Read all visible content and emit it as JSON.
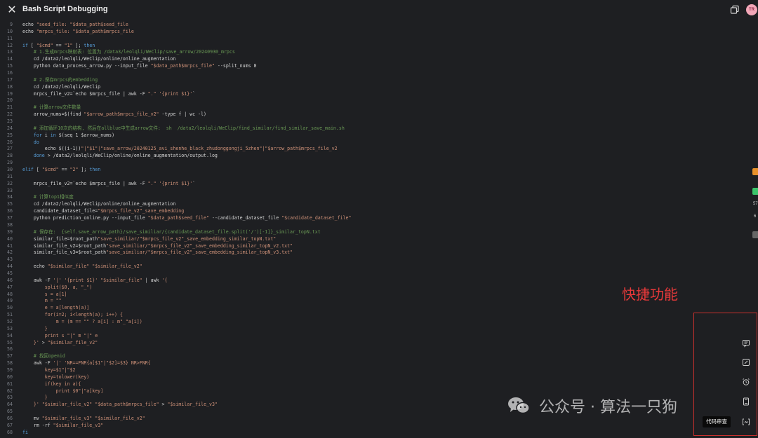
{
  "window": {
    "title": "Bash Script Debugging",
    "avatar_initials": "TR"
  },
  "code_lines": [
    {
      "n": "9",
      "segs": [
        [
          "plain",
          "echo "
        ],
        [
          "str",
          "\"seed_file: \"$data_path$seed_file"
        ]
      ]
    },
    {
      "n": "10",
      "segs": [
        [
          "plain",
          "echo "
        ],
        [
          "str",
          "\"mrpcs_file: \"$data_path$mrpcs_file"
        ]
      ]
    },
    {
      "n": "11",
      "segs": []
    },
    {
      "n": "12",
      "segs": [
        [
          "kw",
          "if"
        ],
        [
          "plain",
          " [ "
        ],
        [
          "str",
          "\"$cmd\""
        ],
        [
          "plain",
          " == "
        ],
        [
          "str",
          "\"1\""
        ],
        [
          "plain",
          " ]; "
        ],
        [
          "kw",
          "then"
        ]
      ]
    },
    {
      "n": "13",
      "segs": [
        [
          "cmt",
          "    # 1.生成mrpcs映射表: 位置为 /data3/leolqli/WeClip/save_arrow/20240930_mrpcs"
        ]
      ]
    },
    {
      "n": "14",
      "segs": [
        [
          "plain",
          "    cd /data2/leolqli/WeClip/online/online_augmentation"
        ]
      ]
    },
    {
      "n": "15",
      "segs": [
        [
          "plain",
          "    python data_process_arrow.py --input_file "
        ],
        [
          "str",
          "\"$data_path$mrpcs_file\""
        ],
        [
          "plain",
          " --split_nums 8"
        ]
      ]
    },
    {
      "n": "16",
      "segs": []
    },
    {
      "n": "17",
      "segs": [
        [
          "cmt",
          "    # 2.保存mrpcs的embedding"
        ]
      ]
    },
    {
      "n": "18",
      "segs": [
        [
          "plain",
          "    cd /data2/leolqli/WeClip"
        ]
      ]
    },
    {
      "n": "19",
      "segs": [
        [
          "plain",
          "    mrpcs_file_v2=`echo $mrpcs_file | awk -F "
        ],
        [
          "str",
          "\".\""
        ],
        [
          "plain",
          " "
        ],
        [
          "str",
          "'{print $1}'"
        ],
        [
          "plain",
          "`"
        ]
      ]
    },
    {
      "n": "20",
      "segs": []
    },
    {
      "n": "21",
      "segs": [
        [
          "cmt",
          "    # 计算arrow文件数量"
        ]
      ]
    },
    {
      "n": "22",
      "segs": [
        [
          "plain",
          "    arrow_nums=$(find "
        ],
        [
          "str",
          "\"$arrow_path$mrpcs_file_v2\""
        ],
        [
          "plain",
          " -type f | wc -l)"
        ]
      ]
    },
    {
      "n": "23",
      "segs": []
    },
    {
      "n": "24",
      "segs": [
        [
          "cmt",
          "    # 添加循环10次的结构, 然后在allblue中生成arrow文件:  sh  /data2/leolqli/WeClip/find_similar/find_similar_save_main.sh"
        ]
      ]
    },
    {
      "n": "25",
      "segs": [
        [
          "plain",
          "    "
        ],
        [
          "kw",
          "for"
        ],
        [
          "plain",
          " i "
        ],
        [
          "kw",
          "in"
        ],
        [
          "plain",
          " $(seq 1 $arrow_nums)"
        ]
      ]
    },
    {
      "n": "26",
      "segs": [
        [
          "plain",
          "    "
        ],
        [
          "kw",
          "do"
        ]
      ]
    },
    {
      "n": "27",
      "segs": [
        [
          "plain",
          "        echo $((i-1))"
        ],
        [
          "str",
          "\"|\"$1\"|\"save_arrow/20240125_avi_shenhe_black_zhudonggongji_5zhen\"|\"$arrow_path$mrpcs_file_v2"
        ]
      ]
    },
    {
      "n": "28",
      "segs": [
        [
          "plain",
          "    "
        ],
        [
          "kw",
          "done"
        ],
        [
          "plain",
          " > /data2/leolqli/WeClip/online/online_augmentation/output.log"
        ]
      ]
    },
    {
      "n": "29",
      "segs": []
    },
    {
      "n": "30",
      "segs": [
        [
          "kw",
          "elif"
        ],
        [
          "plain",
          " [ "
        ],
        [
          "str",
          "\"$cmd\""
        ],
        [
          "plain",
          " == "
        ],
        [
          "str",
          "\"2\""
        ],
        [
          "plain",
          " ]; "
        ],
        [
          "kw",
          "then"
        ]
      ]
    },
    {
      "n": "31",
      "segs": []
    },
    {
      "n": "32",
      "segs": [
        [
          "plain",
          "    mrpcs_file_v2=`echo $mrpcs_file | awk -F "
        ],
        [
          "str",
          "\".\""
        ],
        [
          "plain",
          " "
        ],
        [
          "str",
          "'{print $1}'"
        ],
        [
          "plain",
          "`"
        ]
      ]
    },
    {
      "n": "33",
      "segs": []
    },
    {
      "n": "34",
      "segs": [
        [
          "cmt",
          "    # 计算top1相似度"
        ]
      ]
    },
    {
      "n": "35",
      "segs": [
        [
          "plain",
          "    cd /data2/leolqli/WeClip/online/online_augmentation"
        ]
      ]
    },
    {
      "n": "36",
      "segs": [
        [
          "plain",
          "    candidate_dataset_file="
        ],
        [
          "str",
          "\"$mrpcs_file_v2\"_save_embedding"
        ]
      ]
    },
    {
      "n": "37",
      "segs": [
        [
          "plain",
          "    python prediction_online.py --input_file "
        ],
        [
          "str",
          "\"$data_path$seed_file\""
        ],
        [
          "plain",
          " --candidate_dataset_file "
        ],
        [
          "str",
          "\"$candidate_dataset_file\""
        ]
      ]
    },
    {
      "n": "38",
      "segs": []
    },
    {
      "n": "39",
      "segs": [
        [
          "cmt",
          "    # 保存在:  {self.save_arrow_path}/save_similiar/{candidate_dataset_file.split('/')[-1]}_similar_topN.txt"
        ]
      ]
    },
    {
      "n": "40",
      "segs": [
        [
          "plain",
          "    similar_file=$root_path"
        ],
        [
          "str",
          "\"save_similiar/\"$mrpcs_file_v2\"_save_embedding_similar_topN.txt\""
        ]
      ]
    },
    {
      "n": "41",
      "segs": [
        [
          "plain",
          "    similar_file_v2=$root_path"
        ],
        [
          "str",
          "\"save_similiar/\"$mrpcs_file_v2\"_save_embedding_similar_topN_v2.txt\""
        ]
      ]
    },
    {
      "n": "42",
      "segs": [
        [
          "plain",
          "    similar_file_v3=$root_path"
        ],
        [
          "str",
          "\"save_similiar/\"$mrpcs_file_v2\"_save_embedding_similar_topN_v3.txt\""
        ]
      ]
    },
    {
      "n": "43",
      "segs": []
    },
    {
      "n": "44",
      "segs": [
        [
          "plain",
          "    echo "
        ],
        [
          "str",
          "\"$similar_file\" \"$similar_file_v2\""
        ]
      ]
    },
    {
      "n": "45",
      "segs": []
    },
    {
      "n": "46",
      "segs": [
        [
          "plain",
          "    awk -F "
        ],
        [
          "str",
          "'|'"
        ],
        [
          "plain",
          " "
        ],
        [
          "str",
          "'{print $1}'"
        ],
        [
          "plain",
          " "
        ],
        [
          "str",
          "\"$similar_file\""
        ],
        [
          "plain",
          " | awk "
        ],
        [
          "str",
          "'{"
        ]
      ]
    },
    {
      "n": "47",
      "segs": [
        [
          "str",
          "        split($0, a, \"_\")"
        ]
      ]
    },
    {
      "n": "48",
      "segs": [
        [
          "str",
          "        s = a[1]"
        ]
      ]
    },
    {
      "n": "49",
      "segs": [
        [
          "str",
          "        m = \"\""
        ]
      ]
    },
    {
      "n": "50",
      "segs": [
        [
          "str",
          "        e = a[length(a)]"
        ]
      ]
    },
    {
      "n": "51",
      "segs": [
        [
          "str",
          "        for(i=2; i<length(a); i++) {"
        ]
      ]
    },
    {
      "n": "52",
      "segs": [
        [
          "str",
          "            m = (m == \"\" ? a[i] : m\"_\"a[i])"
        ]
      ]
    },
    {
      "n": "53",
      "segs": [
        [
          "str",
          "        }"
        ]
      ]
    },
    {
      "n": "54",
      "segs": [
        [
          "str",
          "        print s \"|\" m \"|\" e"
        ]
      ]
    },
    {
      "n": "55",
      "segs": [
        [
          "str",
          "    }'"
        ],
        [
          "plain",
          " > "
        ],
        [
          "str",
          "\"$similar_file_v2\""
        ]
      ]
    },
    {
      "n": "56",
      "segs": []
    },
    {
      "n": "57",
      "segs": [
        [
          "cmt",
          "    # 找回openid"
        ]
      ]
    },
    {
      "n": "58",
      "segs": [
        [
          "plain",
          "    awk -F "
        ],
        [
          "str",
          "'|'"
        ],
        [
          "plain",
          " "
        ],
        [
          "str",
          "'NR==FNR{a[$1\"|\"$2]=$3} NR>FNR{"
        ]
      ]
    },
    {
      "n": "59",
      "segs": [
        [
          "str",
          "        key=$1\"|\"$2"
        ]
      ]
    },
    {
      "n": "60",
      "segs": [
        [
          "str",
          "        key=tolower(key)"
        ]
      ]
    },
    {
      "n": "61",
      "segs": [
        [
          "str",
          "        if(key in a){"
        ]
      ]
    },
    {
      "n": "62",
      "segs": [
        [
          "str",
          "            print $0\"|\"a[key]"
        ]
      ]
    },
    {
      "n": "63",
      "segs": [
        [
          "str",
          "        }"
        ]
      ]
    },
    {
      "n": "64",
      "segs": [
        [
          "str",
          "    }'"
        ],
        [
          "plain",
          " "
        ],
        [
          "str",
          "\"$similar_file_v2\" \"$data_path$mrpcs_file\""
        ],
        [
          "plain",
          " > "
        ],
        [
          "str",
          "\"$similar_file_v3\""
        ]
      ]
    },
    {
      "n": "65",
      "segs": []
    },
    {
      "n": "66",
      "segs": [
        [
          "plain",
          "    mv "
        ],
        [
          "str",
          "\"$similar_file_v3\" \"$similar_file_v2\""
        ]
      ]
    },
    {
      "n": "67",
      "segs": [
        [
          "plain",
          "    rm -rf "
        ],
        [
          "str",
          "\"$similar_file_v3\""
        ]
      ]
    },
    {
      "n": "68",
      "segs": [
        [
          "kw",
          "fi"
        ]
      ]
    }
  ],
  "annotation": {
    "label": "快捷功能",
    "color": "#e8393a"
  },
  "side_tools": [
    {
      "name": "comment-icon"
    },
    {
      "name": "edit-icon"
    },
    {
      "name": "alarm-icon"
    },
    {
      "name": "book-icon"
    },
    {
      "name": "code-review-icon"
    }
  ],
  "tooltip": "代码审查",
  "watermark": {
    "text": "公众号 · 算法一只狗"
  },
  "edge": {
    "num1": "57",
    "num2": "6"
  },
  "colors": {
    "keyword": "#569cd6",
    "string": "#ce9178",
    "comment": "#6a9955",
    "background": "#1e1f22"
  }
}
